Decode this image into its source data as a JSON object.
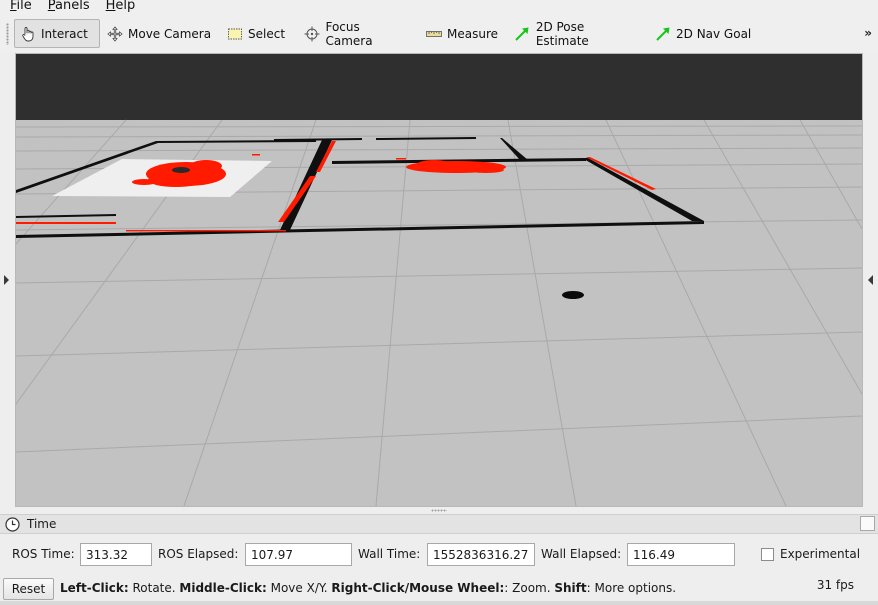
{
  "menubar": {
    "items": [
      {
        "label": "File"
      },
      {
        "label": "Panels"
      },
      {
        "label": "Help"
      }
    ]
  },
  "toolbar": {
    "tools": [
      {
        "label": "Interact",
        "icon": "hand-pointer-icon",
        "active": true
      },
      {
        "label": "Move Camera",
        "icon": "move-arrows-icon",
        "active": false
      },
      {
        "label": "Select",
        "icon": "selection-rectangle-icon",
        "active": false
      },
      {
        "label": "Focus Camera",
        "icon": "crosshair-icon",
        "active": false
      },
      {
        "label": "Measure",
        "icon": "ruler-icon",
        "active": false
      },
      {
        "label": "2D Pose Estimate",
        "icon": "green-arrow-icon",
        "active": false
      },
      {
        "label": "2D Nav Goal",
        "icon": "green-arrow-icon",
        "active": false
      }
    ],
    "overflow": "»"
  },
  "view": {
    "background_color": "#2f2f2f",
    "ground_color": "#c2c2c2",
    "grid_color": "#a8a8a8",
    "map_wall_color": "#0d0d0d",
    "laser_color": "#ff1a00"
  },
  "time_panel": {
    "title": "Time",
    "ros_time_label": "ROS Time:",
    "ros_time": "313.32",
    "ros_elapsed_label": "ROS Elapsed:",
    "ros_elapsed": "107.97",
    "wall_time_label": "Wall Time:",
    "wall_time": "1552836316.27",
    "wall_elapsed_label": "Wall Elapsed:",
    "wall_elapsed": "116.49",
    "experimental_label": "Experimental",
    "experimental_checked": false
  },
  "status": {
    "reset_label": "Reset",
    "hint_parts": [
      {
        "text": "Left-Click:",
        "bold": true
      },
      {
        "text": " Rotate. ",
        "bold": false
      },
      {
        "text": "Middle-Click:",
        "bold": true
      },
      {
        "text": " Move X/Y. ",
        "bold": false
      },
      {
        "text": "Right-Click/Mouse Wheel:",
        "bold": true
      },
      {
        "text": ": Zoom. ",
        "bold": false
      },
      {
        "text": "Shift",
        "bold": true
      },
      {
        "text": ": More options.",
        "bold": false
      }
    ],
    "fps": "31 fps"
  }
}
